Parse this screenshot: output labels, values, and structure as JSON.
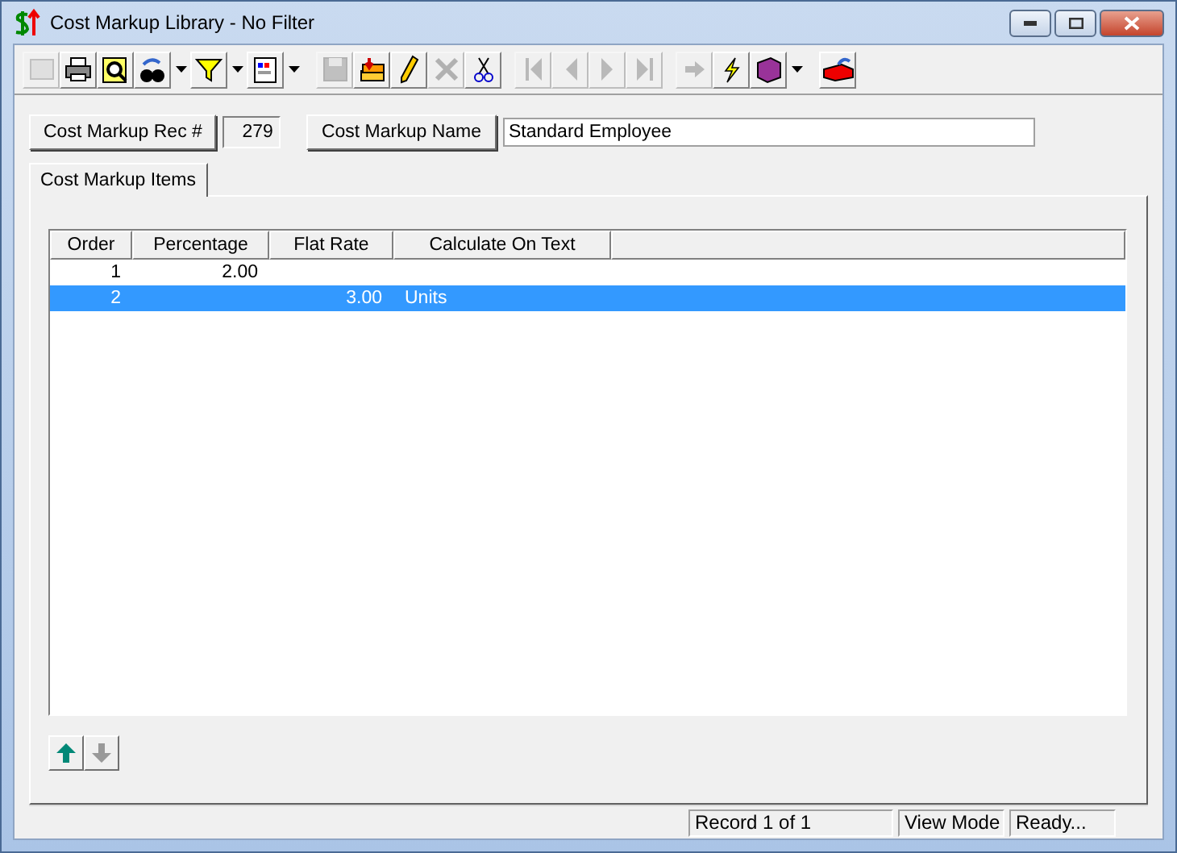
{
  "window": {
    "title": "Cost Markup Library - No Filter"
  },
  "toolbar": [
    [
      {
        "disabled": true,
        "menu": false
      },
      {
        "disabled": false,
        "menu": false
      },
      {
        "disabled": false,
        "menu": false
      },
      {
        "disabled": false,
        "menu": true
      },
      {
        "disabled": false,
        "menu": true
      },
      {
        "disabled": false,
        "menu": true
      }
    ],
    [
      {
        "disabled": true,
        "menu": false
      },
      {
        "disabled": false,
        "menu": false
      },
      {
        "disabled": false,
        "menu": false
      },
      {
        "disabled": true,
        "menu": false
      },
      {
        "disabled": false,
        "menu": false
      }
    ],
    [
      {
        "disabled": true,
        "menu": false
      },
      {
        "disabled": true,
        "menu": false
      },
      {
        "disabled": true,
        "menu": false
      },
      {
        "disabled": true,
        "menu": false
      }
    ],
    [
      {
        "disabled": true,
        "menu": false
      },
      {
        "disabled": false,
        "menu": false
      },
      {
        "disabled": false,
        "menu": true
      }
    ],
    [
      {
        "disabled": false,
        "menu": false
      }
    ]
  ],
  "header": {
    "rec_button": "Cost Markup Rec #",
    "rec_value": "279",
    "name_button": "Cost Markup Name",
    "name_value": "Standard Employee"
  },
  "tabs": [
    {
      "label": "Cost Markup Items",
      "selected": true
    }
  ],
  "table": {
    "columns": [
      "Order",
      "Percentage",
      "Flat Rate",
      "Calculate On Text"
    ],
    "rows": [
      {
        "cells": [
          "1",
          "2.00",
          "",
          ""
        ],
        "selected": false
      },
      {
        "cells": [
          "2",
          "",
          "3.00",
          "Units"
        ],
        "selected": true
      }
    ]
  },
  "move_buttons": [
    {
      "disabled": false
    },
    {
      "disabled": true
    }
  ],
  "status_bar": [
    "Record 1 of 1",
    "View Mode",
    "Ready..."
  ]
}
